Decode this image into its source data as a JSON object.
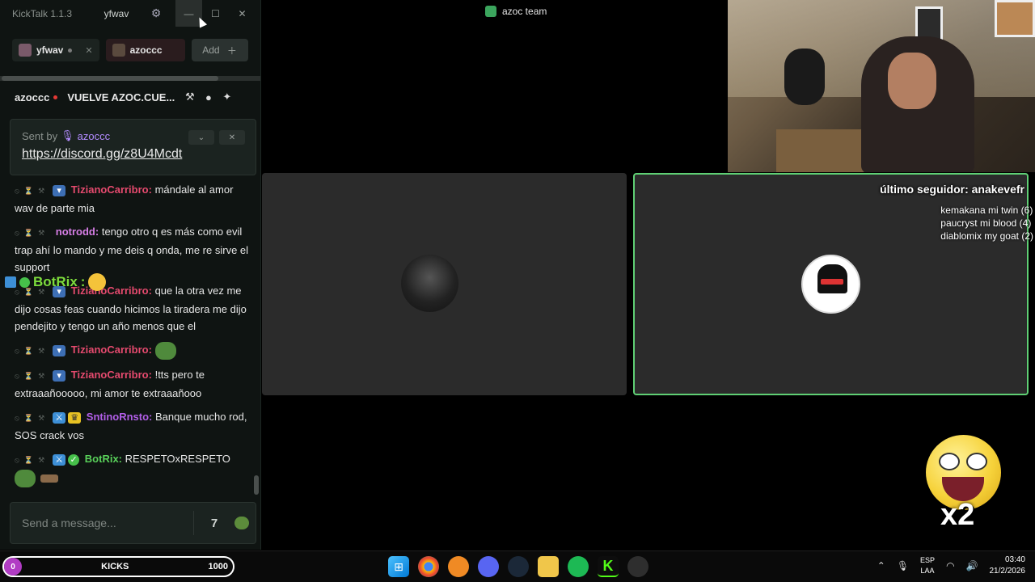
{
  "kicktalk": {
    "app_title": "KickTalk 1.1.3",
    "current_user": "yfwav",
    "tabs": [
      {
        "label": "yfwav"
      },
      {
        "label": "azoccc"
      }
    ],
    "add_label": "Add",
    "channel": {
      "name": "azoccc",
      "stream_title": "VUELVE AZOC.CUE..."
    },
    "pinned": {
      "sent_by_label": "Sent by",
      "sender": "azoccc",
      "link": "https://discord.gg/z8U4Mcdt"
    },
    "messages": [
      {
        "user": "TizianoCarribro:",
        "text": "mándale al amor wav de parte mia",
        "color": "#e54a6e"
      },
      {
        "user": "notrodd:",
        "text": "tengo otro q es más como evil trap ahí lo mando y me deis q onda, me re sirve el support",
        "color": "#d77ee6"
      },
      {
        "user": "TizianoCarribro:",
        "text": "que la otra vez me dijo cosas feas cuando hicimos la tiradera me dijo pendejito y tengo un año menos que el",
        "color": "#e54a6e"
      },
      {
        "user": "TizianoCarribro:",
        "text": "",
        "color": "#e54a6e"
      },
      {
        "user": "TizianoCarribro:",
        "text": "!tts pero te extraaañooooo, mi amor te extraaañooo",
        "color": "#e54a6e"
      },
      {
        "user": "SntinoRnsto:",
        "text": "Banque mucho rod, SOS crack vos",
        "color": "#b25fe8"
      },
      {
        "user": "BotRix:",
        "text": "RESPETOxRESPETO",
        "color": "#59d15a"
      }
    ],
    "overlay_botrix": {
      "user": "BotRix",
      "sep": ":"
    },
    "input_placeholder": "Send a message..."
  },
  "discord": {
    "call_title": "azoc team"
  },
  "overlay": {
    "last_follower": "último seguidor: anakevefr",
    "gifters": [
      "kemakana mi twin (6)",
      "paucryst mi blood (4)",
      "diablomix my goat (2)"
    ],
    "multiplier": "x2"
  },
  "taskbar": {
    "kicks": {
      "count": "0",
      "label": "KICKS",
      "goal": "1000"
    },
    "apps": [
      "windows-start",
      "chrome",
      "fl-studio",
      "discord",
      "steam",
      "file-explorer",
      "spotify",
      "kick",
      "obs"
    ],
    "lang_line1": "ESP",
    "lang_line2": "LAA",
    "time": "03:40",
    "date": "21/2/2026"
  },
  "colors": {
    "accent_kick": "#53fc18",
    "speaking_border": "#5fcf74",
    "live_dot": "#e53935"
  }
}
